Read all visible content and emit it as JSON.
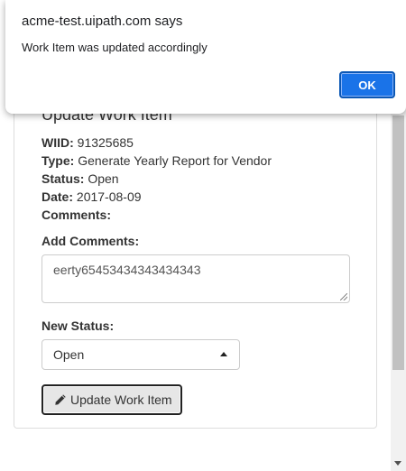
{
  "alert": {
    "title": "acme-test.uipath.com says",
    "message": "Work Item was updated accordingly",
    "ok_label": "OK"
  },
  "panel": {
    "title": "Update Work Item",
    "fields": {
      "wiid_label": "WIID:",
      "wiid_value": "91325685",
      "type_label": "Type:",
      "type_value": "Generate Yearly Report for Vendor",
      "status_label": "Status:",
      "status_value": "Open",
      "date_label": "Date:",
      "date_value": "2017-08-09",
      "comments_label": "Comments:"
    },
    "add_comments_label": "Add Comments:",
    "add_comments_value": "eerty65453434343434343",
    "new_status_label": "New Status:",
    "new_status_selected": "Open",
    "update_button_label": "Update Work Item",
    "update_button_icon": "pencil-icon"
  },
  "colors": {
    "ok_button": "#1a73e8",
    "scroll_thumb": "#c1c1c1"
  }
}
